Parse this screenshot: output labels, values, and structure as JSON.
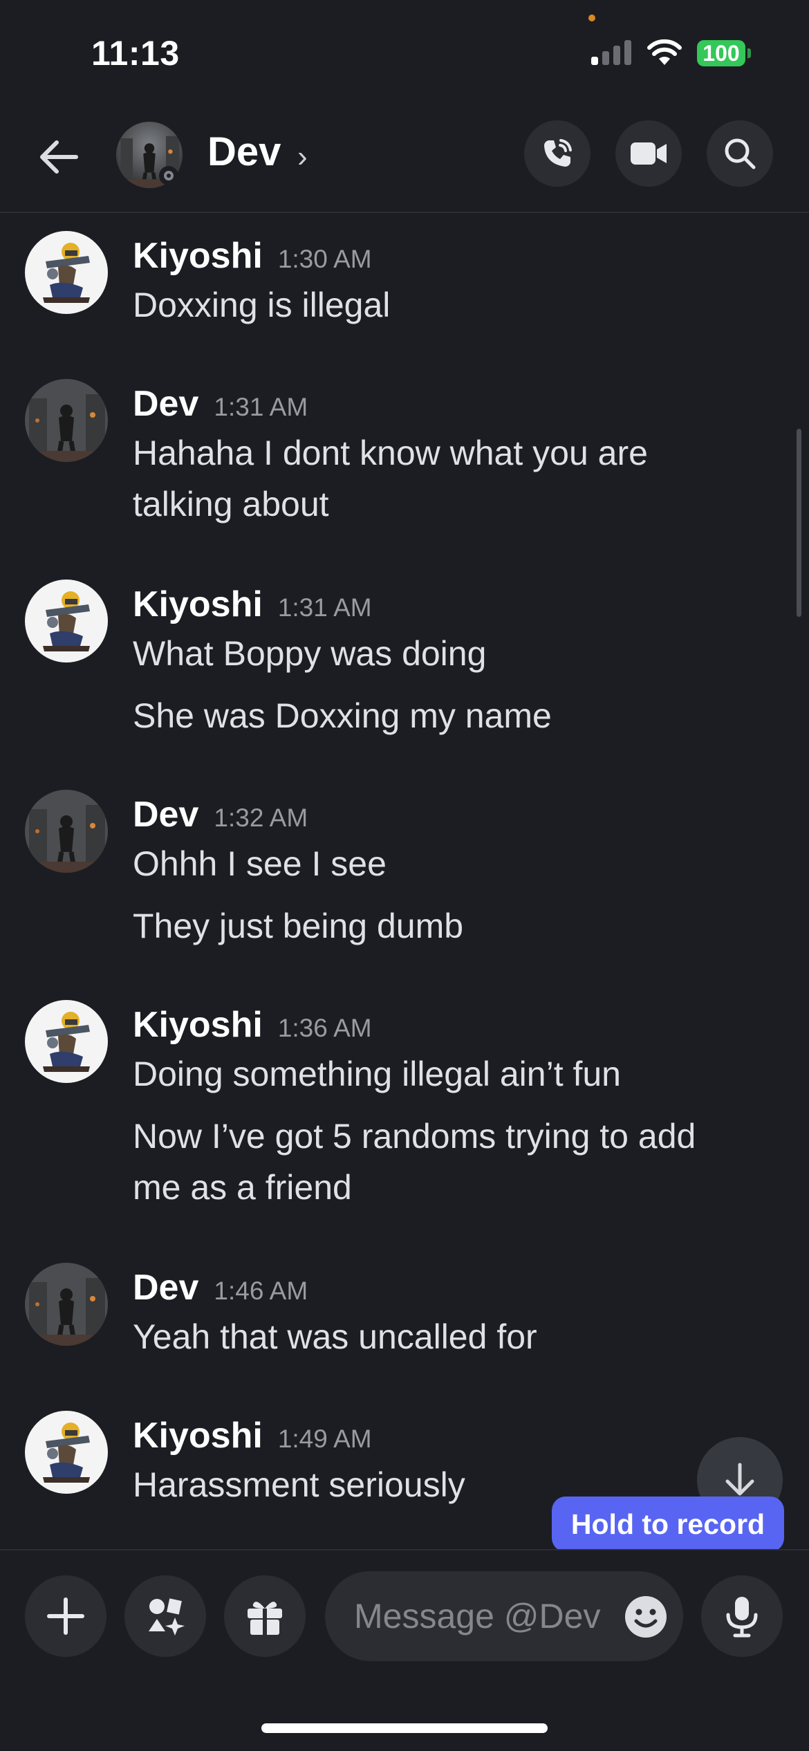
{
  "status_bar": {
    "time": "11:13",
    "battery": "100"
  },
  "header": {
    "name": "Dev",
    "chevron": "›",
    "icons": [
      "back-arrow-icon",
      "voice-call-icon",
      "video-call-icon",
      "search-icon"
    ]
  },
  "messages": [
    {
      "author": "Kiyoshi",
      "time": "1:30 AM",
      "lines": [
        "Doxxing is illegal"
      ]
    },
    {
      "author": "Dev",
      "time": "1:31 AM",
      "lines": [
        "Hahaha I dont know what you are",
        "talking about"
      ]
    },
    {
      "author": "Kiyoshi",
      "time": "1:31 AM",
      "lines": [
        "What Boppy was doing",
        "She was Doxxing my name"
      ]
    },
    {
      "author": "Dev",
      "time": "1:32 AM",
      "lines": [
        "Ohhh I see I see",
        "They just being dumb"
      ]
    },
    {
      "author": "Kiyoshi",
      "time": "1:36 AM",
      "lines": [
        "Doing something illegal ain’t fun",
        "Now I’ve got 5 randoms trying to add",
        "me as a friend"
      ]
    },
    {
      "author": "Dev",
      "time": "1:46 AM",
      "lines": [
        "Yeah that was uncalled for"
      ]
    },
    {
      "author": "Kiyoshi",
      "time": "1:49 AM",
      "lines": [
        "Harassment seriously"
      ]
    }
  ],
  "tooltip": "Hold to record",
  "composer": {
    "placeholder": "Message @Dev"
  },
  "colors": {
    "background": "#1c1d22",
    "button": "#2b2d33",
    "accent": "#5865f2",
    "battery": "#34c759"
  }
}
